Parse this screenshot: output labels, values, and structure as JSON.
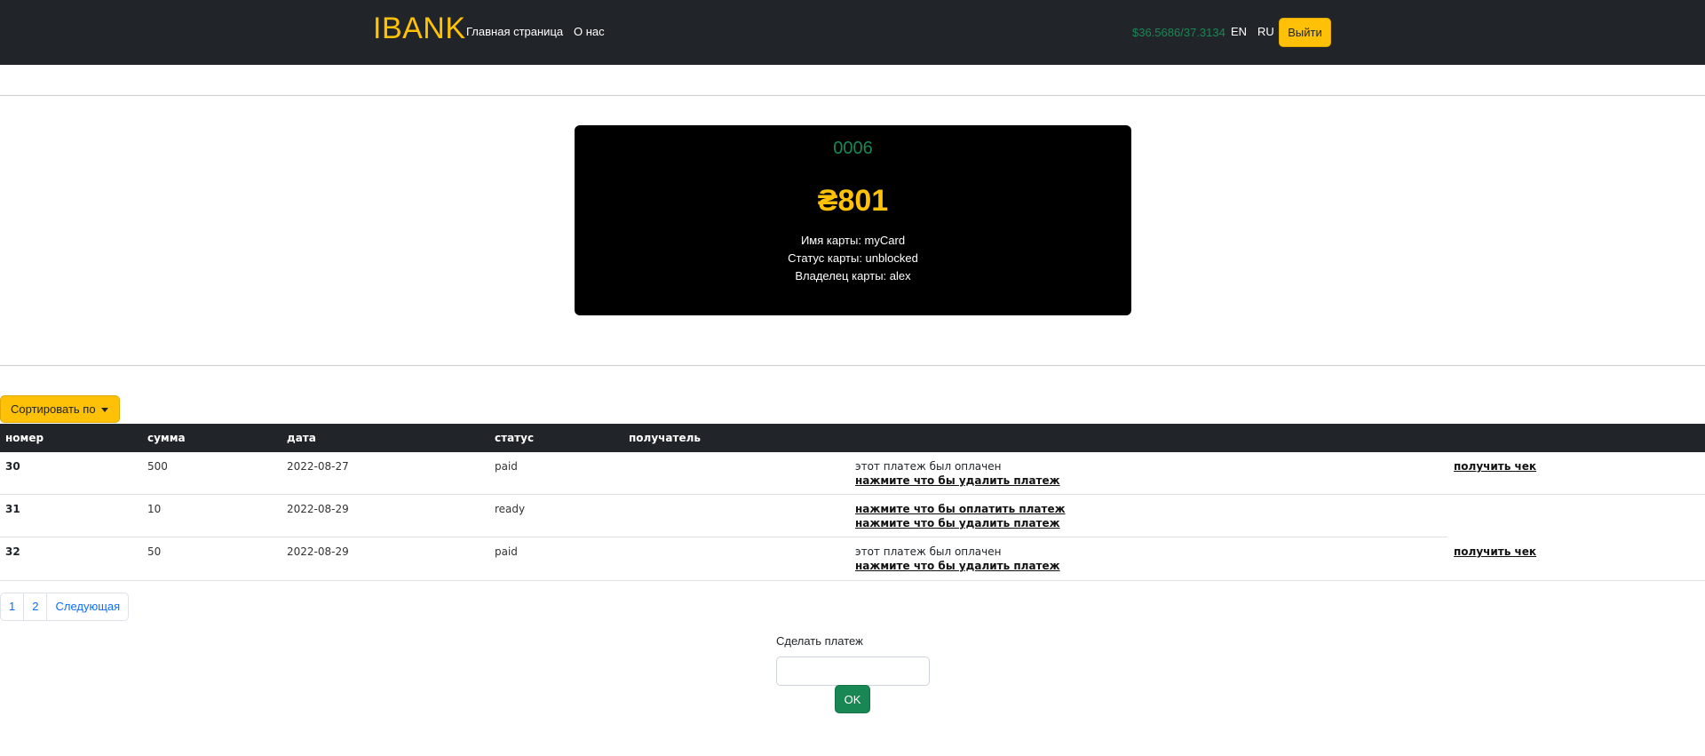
{
  "navbar": {
    "brand": "IBANK",
    "home": "Главная страница",
    "about": "О нас",
    "rate": "$36.5686/37.3134",
    "lang_en": "EN",
    "lang_ru": "RU",
    "logout": "Выйти"
  },
  "card": {
    "number": "0006",
    "balance": "₴801",
    "name_line": "Имя карты: myCard",
    "status_line": "Статус карты: unblocked",
    "owner_line": "Владелец карты: alex"
  },
  "sort": {
    "label": "Сортировать по"
  },
  "table": {
    "headers": [
      "номер",
      "сумма",
      "дата",
      "статус",
      "получатель"
    ],
    "rows": [
      {
        "number": "30",
        "amount": "500",
        "date": "2022-08-27",
        "status": "paid",
        "action1": "этот платеж был оплачен",
        "action2": "нажмите что бы удалить платеж",
        "receipt": "получить чек"
      },
      {
        "number": "31",
        "amount": "10",
        "date": "2022-08-29",
        "status": "ready",
        "action1": "нажмите что бы оплатить платеж",
        "action2": "нажмите что бы удалить платеж",
        "receipt": ""
      },
      {
        "number": "32",
        "amount": "50",
        "date": "2022-08-29",
        "status": "paid",
        "action1": "этот платеж был оплачен",
        "action2": "нажмите что бы удалить платеж",
        "receipt": "получить чек"
      }
    ]
  },
  "pagination": {
    "items": [
      "1",
      "2",
      "Следующая"
    ]
  },
  "payment": {
    "label": "Сделать платеж",
    "input_value": "",
    "submit": "OK"
  },
  "colors": {
    "navbar_bg": "#212529",
    "accent_yellow": "#ffc107",
    "accent_green": "#198754",
    "card_bg": "#000000"
  }
}
